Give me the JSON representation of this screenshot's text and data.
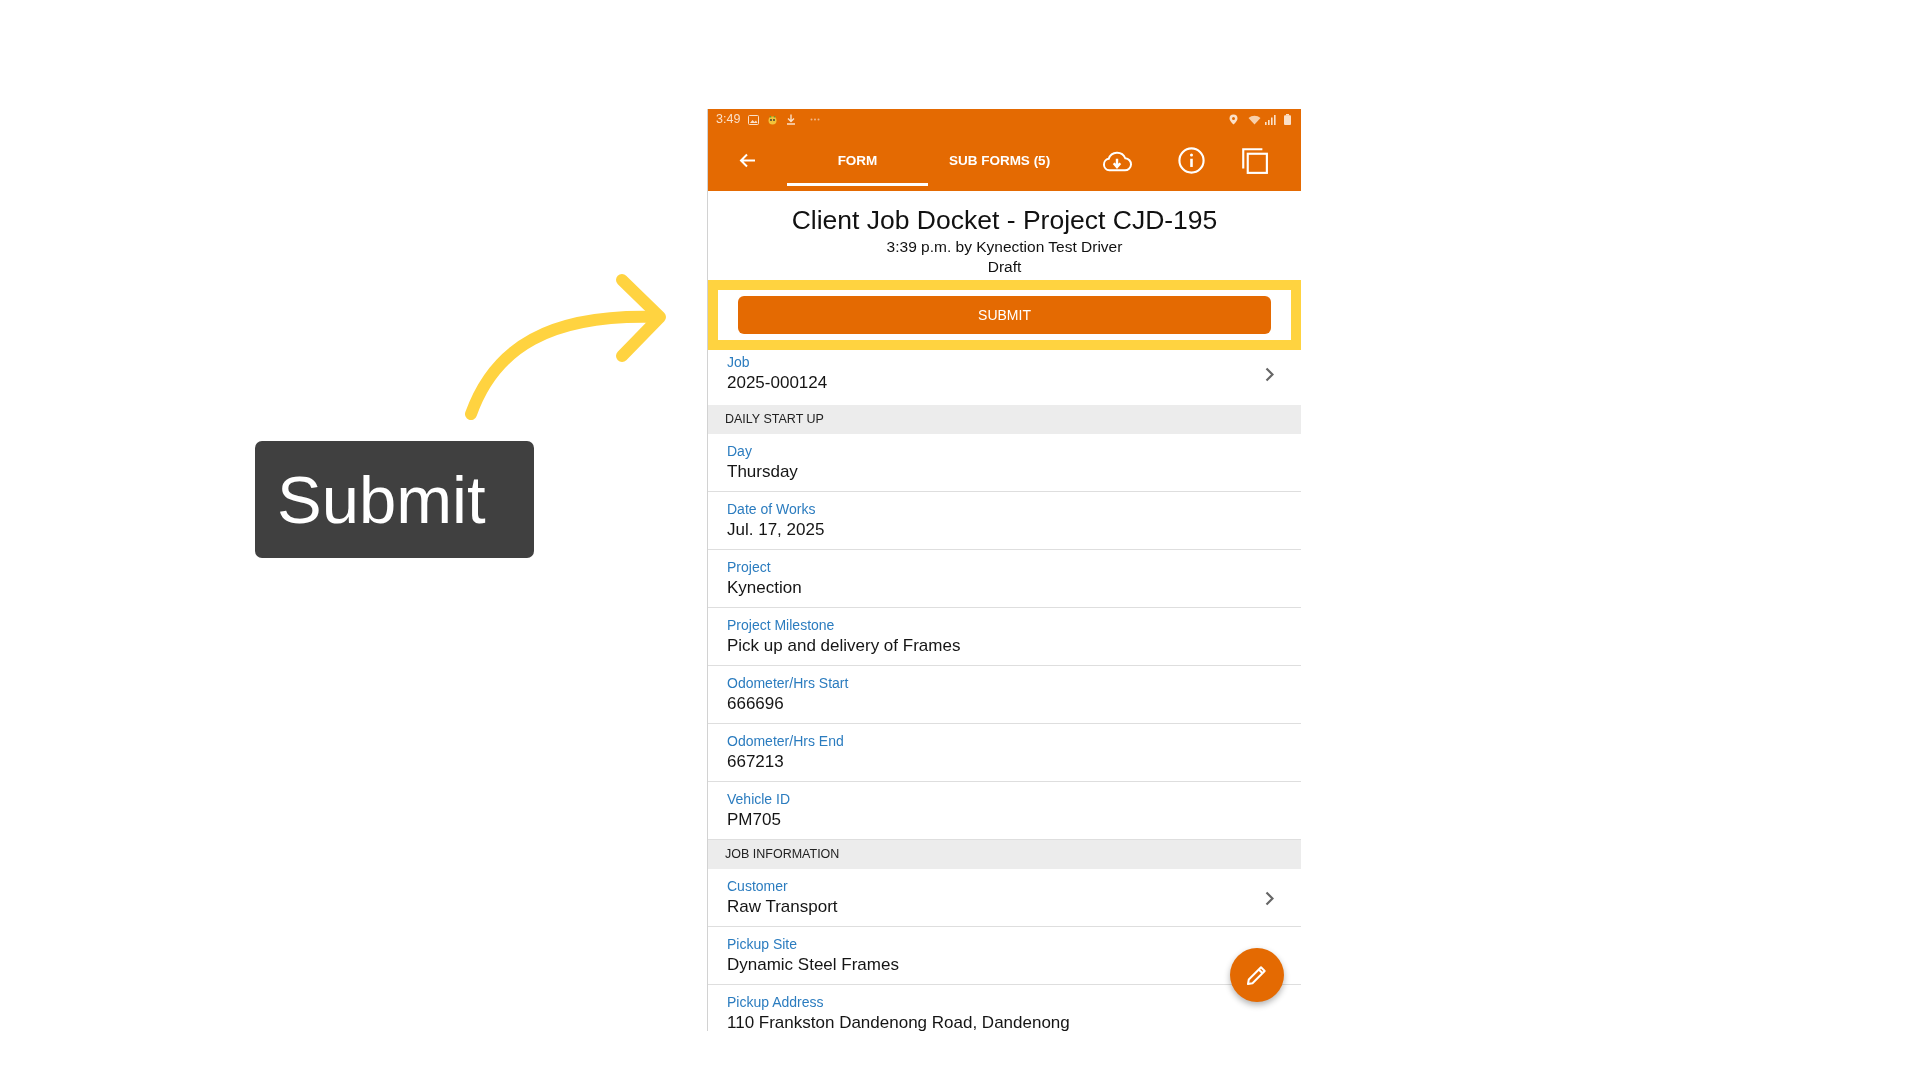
{
  "callout": {
    "text": "Submit"
  },
  "status_bar": {
    "time": "3:49"
  },
  "toolbar": {
    "tabs": [
      {
        "label": "FORM",
        "selected": true
      },
      {
        "label": "SUB FORMS (5)",
        "selected": false
      }
    ]
  },
  "header": {
    "title": "Client Job Docket - Project CJD-195",
    "subtitle": "3:39 p.m. by Kynection Test Driver",
    "status": "Draft"
  },
  "submit_button": {
    "label": "SUBMIT",
    "highlighted": true
  },
  "job_field": {
    "label": "Job",
    "value": "2025-000124",
    "navigable": true
  },
  "sections": [
    {
      "title": "DAILY START UP",
      "fields": [
        {
          "label": "Day",
          "value": "Thursday",
          "navigable": false
        },
        {
          "label": "Date of Works",
          "value": "Jul. 17, 2025",
          "navigable": false
        },
        {
          "label": "Project",
          "value": "Kynection",
          "navigable": false
        },
        {
          "label": "Project Milestone",
          "value": "Pick up and delivery of Frames",
          "navigable": false
        },
        {
          "label": "Odometer/Hrs Start",
          "value": "666696",
          "navigable": false
        },
        {
          "label": "Odometer/Hrs End",
          "value": "667213",
          "navigable": false
        },
        {
          "label": "Vehicle ID",
          "value": "PM705",
          "navigable": false
        }
      ]
    },
    {
      "title": "JOB INFORMATION",
      "fields": [
        {
          "label": "Customer",
          "value": "Raw Transport",
          "navigable": true
        },
        {
          "label": "Pickup Site",
          "value": "Dynamic Steel Frames",
          "navigable": false
        },
        {
          "label": "Pickup Address",
          "value": "110 Frankston Dandenong Road, Dandenong",
          "navigable": false
        }
      ]
    }
  ]
}
